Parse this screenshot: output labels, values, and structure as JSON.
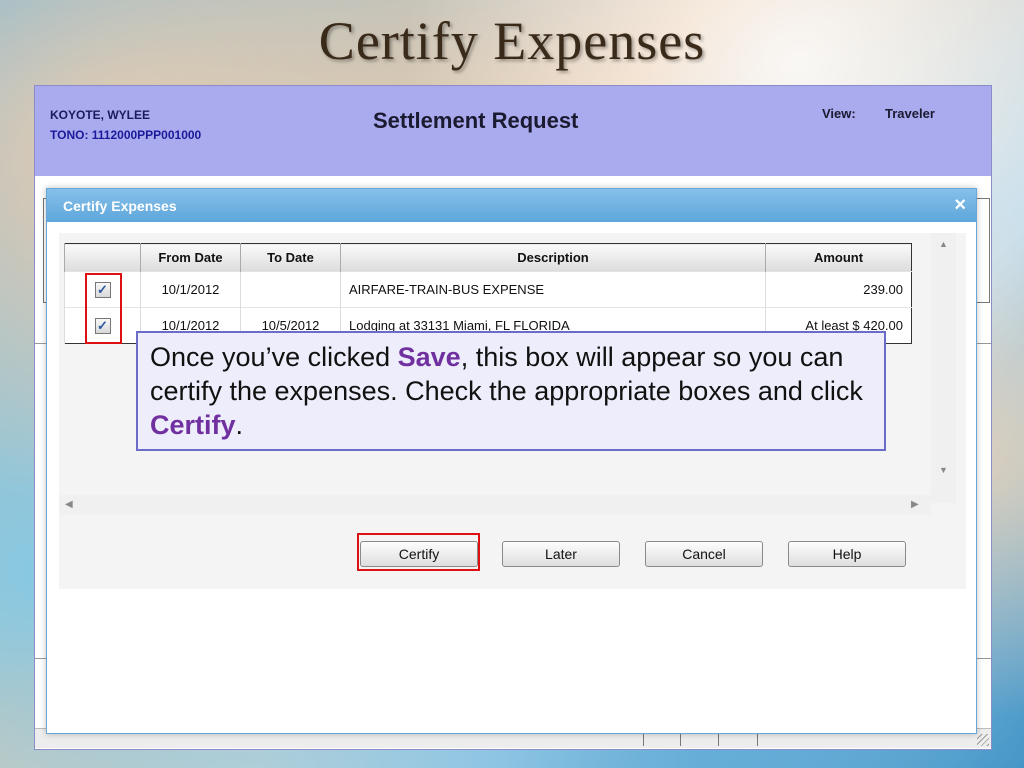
{
  "slide": {
    "title": "Certify Expenses"
  },
  "app": {
    "traveler_name": "KOYOTE, WYLEE",
    "tono": "TONO: 1112000PPP001000",
    "title": "Settlement Request",
    "view_label": "View:",
    "view_value": "Traveler"
  },
  "dialog": {
    "title": "Certify Expenses",
    "close_glyph": "×",
    "columns": [
      "",
      "From Date",
      "To Date",
      "Description",
      "Amount"
    ],
    "rows": [
      {
        "checked": true,
        "check_glyph": "✓",
        "from_date": "10/1/2012",
        "to_date": "",
        "description": "AIRFARE-TRAIN-BUS EXPENSE",
        "amount": "239.00"
      },
      {
        "checked": true,
        "check_glyph": "✓",
        "from_date": "10/1/2012",
        "to_date": "10/5/2012",
        "description": "Lodging at 33131 Miami, FL FLORIDA",
        "amount": "At least $ 420.00"
      }
    ],
    "buttons": {
      "certify": "Certify",
      "later": "Later",
      "cancel": "Cancel",
      "help": "Help"
    }
  },
  "callout": {
    "part1": "Once you’ve clicked ",
    "save": "Save",
    "part2": ", this box will appear so you can certify the expenses. Check the appropriate boxes and click ",
    "certify": "Certify",
    "part3": "."
  },
  "colors": {
    "header_bg": "#aaaaee",
    "dialog_titlebar": "#5ea6db",
    "highlight": "#dd1111",
    "callout_accent": "#7030a0"
  },
  "icons": {
    "close": "close-icon",
    "checkbox": "checkbox-checked-icon"
  }
}
